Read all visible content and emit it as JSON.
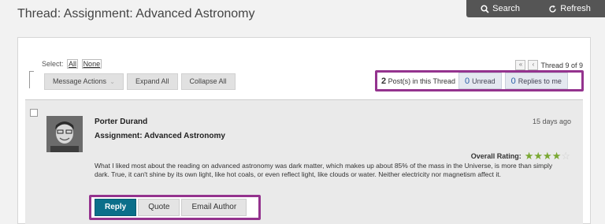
{
  "page": {
    "title": "Thread: Assignment: Advanced Astronomy"
  },
  "topbar": {
    "search_label": "Search",
    "refresh_label": "Refresh",
    "search_icon": "search-icon",
    "refresh_icon": "refresh-icon"
  },
  "toolbar": {
    "select_label": "Select:",
    "select_all": "All",
    "select_none": "None",
    "buttons": [
      "Message Actions",
      "Expand All",
      "Collapse All"
    ]
  },
  "pager": {
    "first": "«",
    "prev": "‹",
    "label": "Thread 9 of 9"
  },
  "stats": {
    "posts_count": "2",
    "posts_label": "Post(s) in this Thread",
    "unread_count": "0",
    "unread_label": "Unread",
    "replies_count": "0",
    "replies_label": "Replies to me"
  },
  "post": {
    "author": "Porter Durand",
    "subject": "Assignment: Advanced Astronomy",
    "time_ago": "15 days ago",
    "rating_label": "Overall Rating:",
    "rating_value": 4,
    "rating_max": 5,
    "body": "What I liked most about the reading on advanced astronomy was dark matter, which makes up about 85% of the mass in the Universe, is more than simply dark. True, it can't shine by its own light, like hot coals, or even reflect light, like clouds or water. Neither electricity nor magnetism affect it.",
    "actions": {
      "reply": "Reply",
      "quote": "Quote",
      "email": "Email Author"
    }
  },
  "colors": {
    "highlight": "#94338e",
    "primary_button": "#0b6f8a",
    "star": "#7aa832"
  }
}
